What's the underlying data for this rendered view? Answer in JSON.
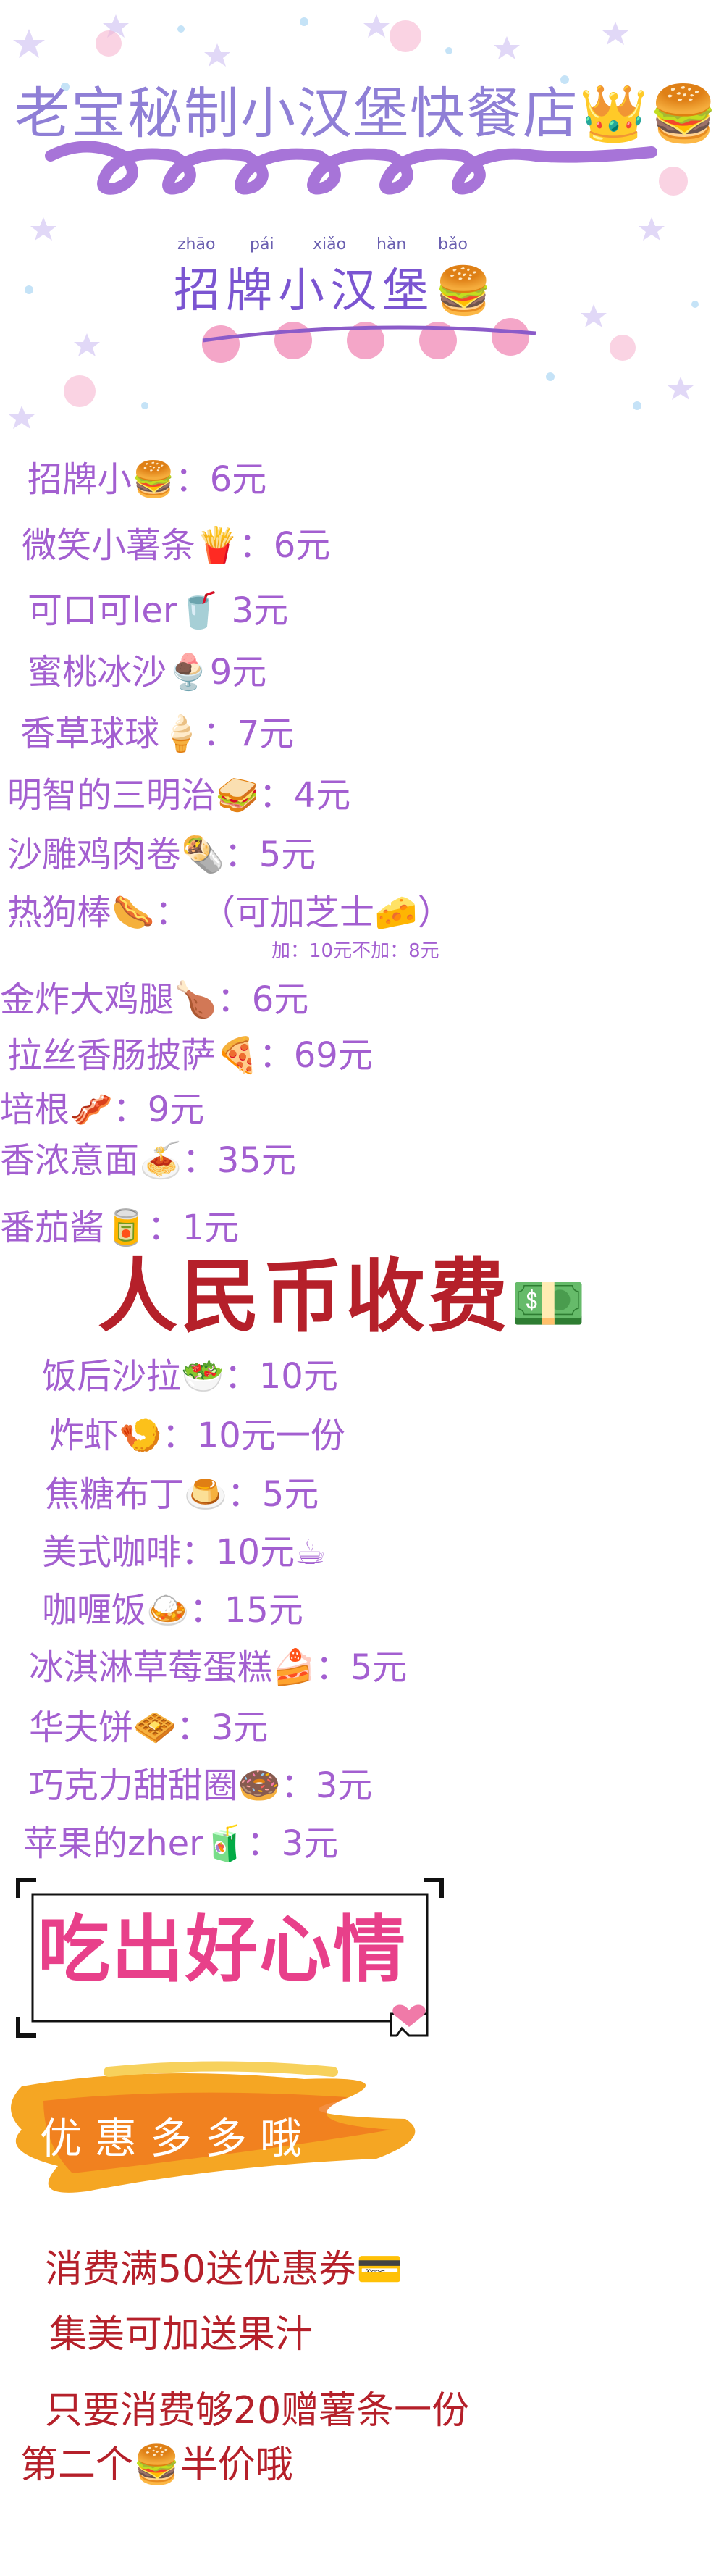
{
  "header": {
    "title": "老宝秘制小汉堡快餐店",
    "title_icon": "crown-burger-icon",
    "subtitle": "招牌小汉堡",
    "subtitle_icon": "burger-icon",
    "pinyin": [
      "zhāo",
      "pái",
      "xiǎo",
      "hàn",
      "bǎo"
    ]
  },
  "menu_items": [
    {
      "text": "招牌小🍔：6元"
    },
    {
      "text": "微笑小薯条🍟：6元"
    },
    {
      "text": "可口可ler🥤 3元"
    },
    {
      "text": "蜜桃冰沙🍨9元"
    },
    {
      "text": "香草球球🍦：7元"
    },
    {
      "text": "明智的三明治🥪：4元"
    },
    {
      "text": "沙雕鸡肉卷🌯：5元"
    },
    {
      "text": "热狗棒🌭：  （可加芝士🧀）"
    },
    {
      "text": "金炸大鸡腿🍗：6元"
    },
    {
      "text": "拉丝香肠披萨🍕：69元"
    },
    {
      "text": "培根🥓：9元"
    },
    {
      "text": "香浓意面🍝：35元"
    },
    {
      "text": "番茄酱🥫：1元"
    }
  ],
  "hotdog_note": "加：10元不加：8元",
  "currency_notice": "人民币收费",
  "currency_icon": "money-icon",
  "menu_items_2": [
    {
      "text": "饭后沙拉🥗：10元"
    },
    {
      "text": "炸虾🍤：10元一份"
    },
    {
      "text": "焦糖布丁🍮：5元"
    },
    {
      "text": "美式咖啡：10元☕"
    },
    {
      "text": "咖喱饭🍛：15元"
    },
    {
      "text": "冰淇淋草莓蛋糕🍰：5元"
    },
    {
      "text": "华夫饼🧇：3元"
    },
    {
      "text": "巧克力甜甜圈🍩：3元"
    },
    {
      "text": "苹果的zher🧃：3元"
    }
  ],
  "slogan": "吃出好心情",
  "promo_title": "优惠多多哦",
  "promotions": [
    {
      "text": "消费满50送优惠券💳"
    },
    {
      "text": "集美可加送果汁"
    },
    {
      "text": "只要消费够20赠薯条一份"
    },
    {
      "text": "第二个🍔半价哦"
    }
  ],
  "colors": {
    "menu_text": "#a35fd0",
    "rmb_text": "#b5202a",
    "slogan_text": "#e8408a",
    "promo_banner": "#f28a1e"
  }
}
